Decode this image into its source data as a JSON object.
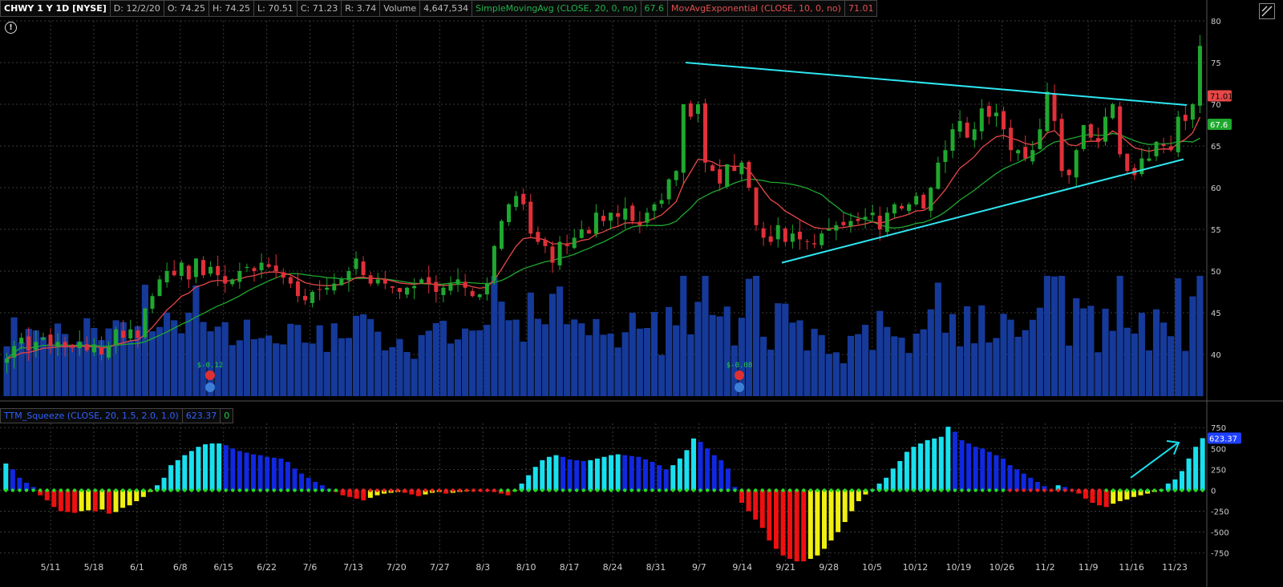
{
  "header": {
    "symbol": "CHWY 1 Y 1D [NYSE]",
    "date": "D: 12/2/20",
    "open": "O: 74.25",
    "high": "H: 74.25",
    "low": "L: 70.51",
    "close": "C: 71.23",
    "range": "R: 3.74",
    "volume_label": "Volume",
    "volume_value": "4,647,534",
    "sma_label": "SimpleMovingAvg (CLOSE, 20, 0, no)",
    "sma_value": "67.6",
    "ema_label": "MovAvgExponential (CLOSE, 10, 0, no)",
    "ema_value": "71.01"
  },
  "lower_header": {
    "label": "TTM_Squeeze (CLOSE, 20, 1.5, 2.0, 1.0)",
    "value": "623.37",
    "squeeze_value": "0"
  },
  "events": [
    {
      "label": "$-0.12"
    },
    {
      "label": "$-0.08"
    }
  ],
  "colors": {
    "up_candle": "#1fa82f",
    "down_candle": "#e0303a",
    "volume": "#163a9a",
    "sma": "#1fa82f",
    "ema": "#e84848",
    "trendline": "#2ee6f0",
    "squeeze_cyan": "#19e0ee",
    "squeeze_blue": "#1028e0",
    "squeeze_red": "#ee1010",
    "squeeze_yellow": "#f0f010",
    "squeeze_dot": "#22dd22"
  },
  "chart_data": [
    {
      "type": "candlestick",
      "title": "CHWY 1 Y 1D [NYSE]",
      "x_ticks": [
        "5/11",
        "5/18",
        "6/1",
        "6/8",
        "6/15",
        "6/22",
        "7/6",
        "7/13",
        "7/20",
        "7/27",
        "8/3",
        "8/10",
        "8/17",
        "8/24",
        "8/31",
        "9/7",
        "9/14",
        "9/21",
        "9/28",
        "10/5",
        "10/12",
        "10/19",
        "10/26",
        "11/2",
        "11/9",
        "11/16",
        "11/23"
      ],
      "y_ticks": [
        40,
        45,
        50,
        55,
        60,
        65,
        70,
        75,
        80
      ],
      "ylim": [
        35,
        80
      ],
      "close_series": [
        39.5,
        41,
        42,
        40.5,
        41.5,
        42,
        41,
        41.5,
        41,
        40.8,
        41.5,
        40.5,
        41.2,
        40,
        41,
        43,
        42,
        43,
        42,
        45.5,
        47,
        49,
        50,
        49.5,
        51,
        49,
        51.5,
        49.5,
        50.5,
        49.5,
        48.5,
        49,
        50,
        50.5,
        50,
        51,
        50.5,
        50,
        49.2,
        48.5,
        47,
        46.5,
        47.5,
        47.8,
        48,
        48.5,
        49,
        50,
        51.5,
        49.5,
        48.5,
        49,
        48.5,
        48,
        47.5,
        48,
        48.2,
        49,
        48.5,
        47.5,
        48,
        48.5,
        49,
        48,
        47,
        47.2,
        48.5,
        53,
        56,
        58,
        59,
        58,
        54.5,
        53.5,
        53,
        51,
        53.5,
        53,
        54,
        55,
        54.5,
        57,
        56,
        57,
        56.5,
        57.5,
        56,
        55.5,
        57,
        58,
        58.5,
        61,
        62,
        70,
        68.5,
        70,
        63,
        62,
        60.5,
        62.8,
        62,
        63,
        60,
        55.5,
        54,
        53.5,
        55.5,
        53.5,
        54.5,
        53.8,
        53.5,
        53.2,
        54.5,
        55,
        55.5,
        55.5,
        56,
        56,
        56.5,
        57,
        55,
        57,
        58,
        57.5,
        58,
        59,
        57.5,
        60,
        63,
        64.5,
        67,
        68,
        66,
        67,
        69.5,
        68.5,
        69,
        67,
        64.5,
        64.5,
        63.5,
        64.5,
        67,
        71.5,
        68,
        62,
        61.5,
        64.5,
        67.5,
        66,
        65.5,
        68.5,
        70,
        64,
        62,
        61.5,
        63.5,
        63.5,
        65.5,
        65,
        64.5,
        68.5,
        68,
        70,
        77
      ],
      "sma_last": 67.6,
      "ema_last": 71.01,
      "volume_note": "relative bars",
      "annotations": [
        "$-0.12",
        "$-0.08"
      ]
    },
    {
      "type": "bar",
      "title": "TTM_Squeeze (CLOSE, 20, 1.5, 2.0, 1.0)",
      "y_ticks": [
        -750,
        -500,
        -250,
        0,
        250,
        500,
        750
      ],
      "ylim": [
        -850,
        800
      ],
      "values": [
        320,
        250,
        150,
        90,
        40,
        -60,
        -120,
        -200,
        -250,
        -260,
        -270,
        -250,
        -240,
        -250,
        -230,
        -280,
        -260,
        -210,
        -180,
        -130,
        -80,
        -20,
        60,
        150,
        300,
        360,
        420,
        470,
        520,
        550,
        560,
        560,
        540,
        500,
        470,
        450,
        430,
        420,
        400,
        390,
        380,
        340,
        260,
        200,
        150,
        100,
        60,
        20,
        -20,
        -60,
        -80,
        -100,
        -120,
        -90,
        -60,
        -40,
        -30,
        -20,
        -30,
        -50,
        -70,
        -50,
        -30,
        -20,
        -40,
        -30,
        -20,
        -10,
        -10,
        -10,
        -10,
        -20,
        -40,
        -60,
        -10,
        80,
        180,
        280,
        360,
        400,
        420,
        400,
        370,
        360,
        350,
        360,
        380,
        400,
        420,
        430,
        420,
        410,
        400,
        370,
        340,
        300,
        250,
        300,
        380,
        480,
        620,
        580,
        500,
        420,
        360,
        260,
        40,
        -150,
        -250,
        -350,
        -450,
        -600,
        -700,
        -780,
        -820,
        -850,
        -850,
        -820,
        -780,
        -700,
        -600,
        -500,
        -380,
        -250,
        -130,
        -50,
        10,
        80,
        150,
        260,
        350,
        460,
        520,
        560,
        600,
        620,
        640,
        760,
        700,
        600,
        560,
        520,
        500,
        460,
        420,
        380,
        300,
        250,
        200,
        150,
        100,
        50,
        -10,
        60,
        40,
        10,
        -40,
        -100,
        -150,
        -180,
        -200,
        -160,
        -130,
        -110,
        -80,
        -60,
        -40,
        -20,
        10,
        80,
        130,
        230,
        380,
        520,
        623.37
      ],
      "last_value": 623.37
    }
  ]
}
